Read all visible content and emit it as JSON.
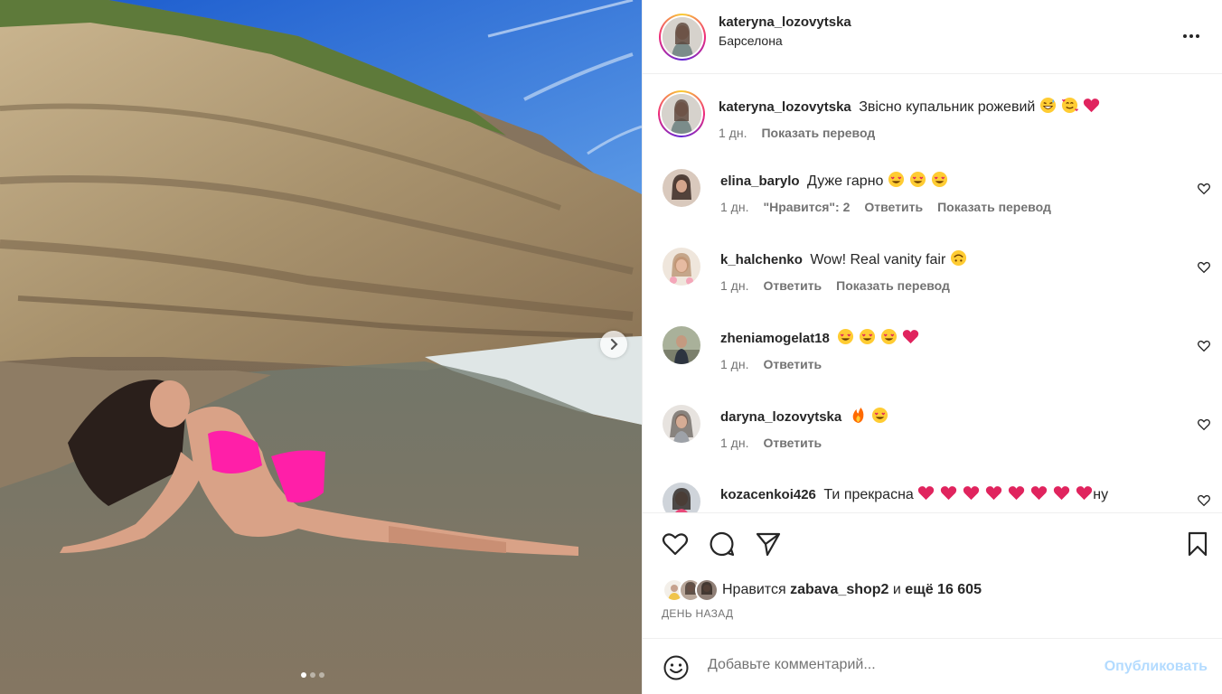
{
  "header": {
    "username": "kateryna_lozovytska",
    "location": "Барселона",
    "more_icon": "more-horizontal-icon"
  },
  "caption": {
    "username": "kateryna_lozovytska",
    "text": "Звісно купальник рожевий",
    "emojis": [
      "grinning-sweat-emoji",
      "smiling-hearts-emoji",
      "red-heart-emoji"
    ],
    "time": "1 дн.",
    "translate": "Показать перевод"
  },
  "comments": [
    {
      "username": "elina_barylo",
      "text": "Дуже гарно",
      "emojis": [
        "heart-eyes-emoji",
        "heart-eyes-emoji",
        "heart-eyes-emoji"
      ],
      "time": "1 дн.",
      "likes": "\"Нравится\": 2",
      "reply": "Ответить",
      "translate": "Показать перевод"
    },
    {
      "username": "k_halchenko",
      "text": "Wow! Real vanity fair",
      "emojis": [
        "upside-down-face-emoji"
      ],
      "time": "1 дн.",
      "reply": "Ответить",
      "translate": "Показать перевод"
    },
    {
      "username": "zheniamogelat18",
      "text": "",
      "emojis": [
        "heart-eyes-emoji",
        "heart-eyes-emoji",
        "heart-eyes-emoji",
        "red-heart-emoji"
      ],
      "time": "1 дн.",
      "reply": "Ответить"
    },
    {
      "username": "daryna_lozovytska",
      "text": "",
      "emojis": [
        "fire-emoji",
        "heart-eyes-emoji"
      ],
      "time": "1 дн.",
      "reply": "Ответить"
    },
    {
      "username": "kozacenkoi426",
      "text": "Ти прекрасна",
      "emojis": [
        "red-heart-emoji",
        "red-heart-emoji",
        "red-heart-emoji",
        "red-heart-emoji",
        "red-heart-emoji",
        "red-heart-emoji",
        "red-heart-emoji",
        "red-heart-emoji"
      ],
      "tail": "ну"
    }
  ],
  "actions": {
    "like_icon": "heart-outline-icon",
    "comment_icon": "comment-icon",
    "share_icon": "send-icon",
    "save_icon": "bookmark-icon"
  },
  "likes": {
    "prefix": "Нравится",
    "user": "zabava_shop2",
    "middle": "и",
    "rest": "ещё 16 605"
  },
  "time_ago": "ДЕНЬ НАЗАД",
  "add_comment": {
    "placeholder": "Добавьте комментарий...",
    "post_label": "Опубликовать",
    "emoji_icon": "smiley-icon"
  },
  "carousel": {
    "slide_count": 3,
    "active_index": 0,
    "next_icon": "chevron-right-icon"
  },
  "colors": {
    "accent": "#0095f6",
    "post_disabled": "#b3dbff",
    "heart_red": "#e0245e",
    "swimsuit_pink": "#ff1fa8",
    "sky": "#2e6fd6"
  }
}
